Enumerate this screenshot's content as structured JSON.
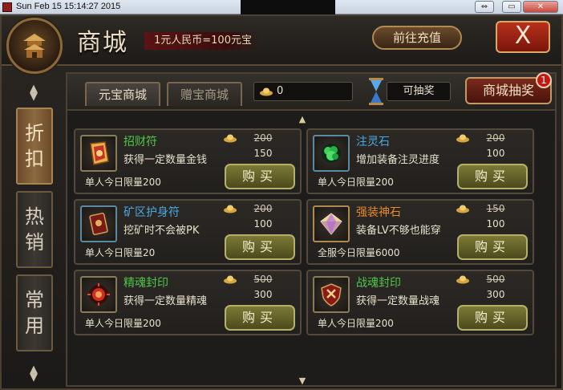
{
  "os_window": {
    "title": "Sun Feb 15 15:14:27 2015",
    "buttons": [
      "⇔",
      "▭",
      "✕"
    ]
  },
  "header": {
    "title": "商城",
    "rate": "1元人民币=100元宝",
    "recharge_label": "前往充值",
    "close_label": "X"
  },
  "side_tabs": [
    {
      "label": "折扣",
      "active": true
    },
    {
      "label": "热销",
      "active": false
    },
    {
      "label": "常用",
      "active": false
    }
  ],
  "topbar": {
    "tabs": [
      {
        "label": "元宝商城",
        "active": true
      },
      {
        "label": "赠宝商城",
        "active": false
      }
    ],
    "yuanbao_balance": "0",
    "draw_label": "可抽奖",
    "lottery_label": "商城抽奖",
    "lottery_badge": "1"
  },
  "items": [
    {
      "name": "招财符",
      "desc": "获得一定数量金钱",
      "old_price": "200",
      "new_price": "150",
      "limit": "单人今日限量200",
      "buy": "购买",
      "name_color": "green",
      "icon": "talisman-icon"
    },
    {
      "name": "注灵石",
      "desc": "增加装备注灵进度",
      "old_price": "200",
      "new_price": "100",
      "limit": "单人今日限量200",
      "buy": "购买",
      "name_color": "blue",
      "icon": "green-gem-icon"
    },
    {
      "name": "矿区护身符",
      "desc": "挖矿时不会被PK",
      "old_price": "200",
      "new_price": "100",
      "limit": "单人今日限量20",
      "buy": "购买",
      "name_color": "blue",
      "icon": "amulet-icon"
    },
    {
      "name": "强装神石",
      "desc": "装备LV不够也能穿",
      "old_price": "150",
      "new_price": "100",
      "limit": "全服今日限量6000",
      "buy": "购买",
      "name_color": "orange",
      "icon": "diamond-icon"
    },
    {
      "name": "精魂封印",
      "desc": "获得一定数量精魂",
      "old_price": "500",
      "new_price": "300",
      "limit": "单人今日限量200",
      "buy": "购买",
      "name_color": "green",
      "icon": "red-seal-icon"
    },
    {
      "name": "战魂封印",
      "desc": "获得一定数量战魂",
      "old_price": "500",
      "new_price": "300",
      "limit": "单人今日限量200",
      "buy": "购买",
      "name_color": "green",
      "icon": "shield-seal-icon"
    }
  ]
}
